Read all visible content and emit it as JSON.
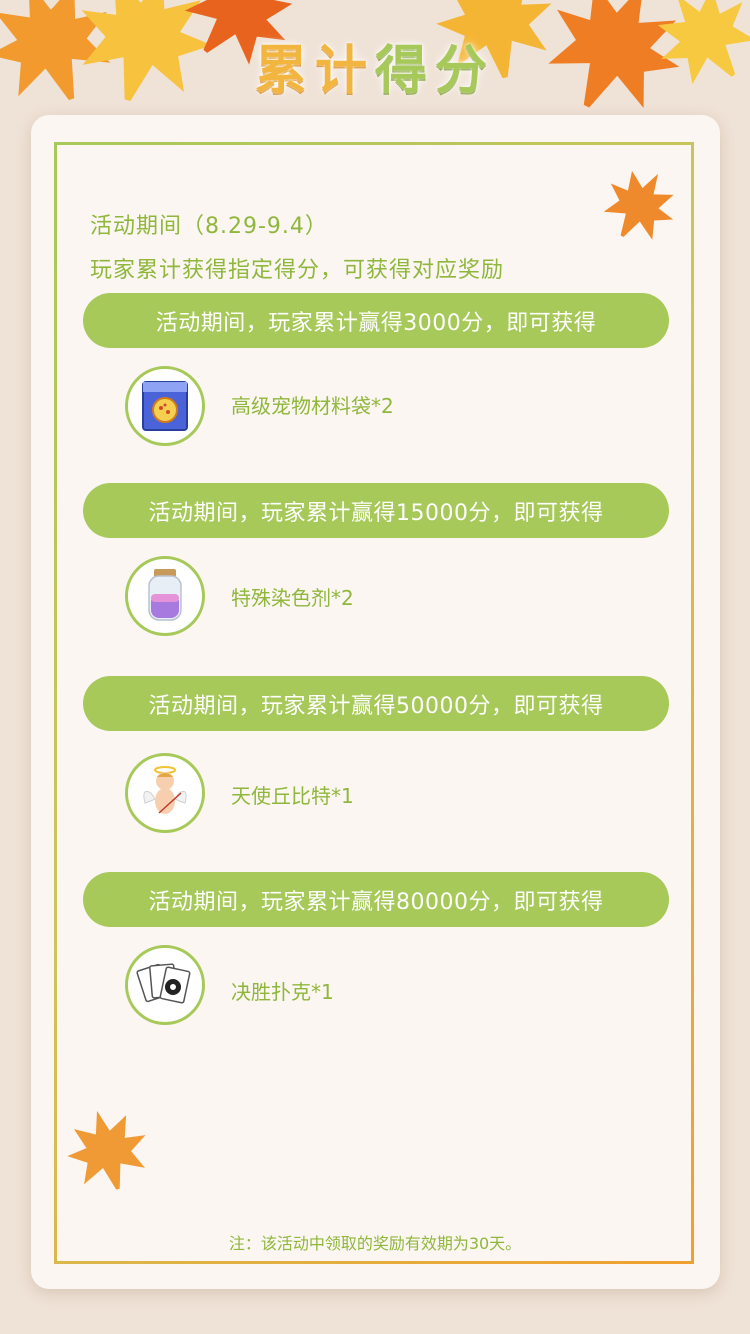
{
  "header": {
    "title_chars": [
      "累",
      "计",
      "得",
      "分"
    ]
  },
  "intro": {
    "period": "活动期间（8.29-9.4）",
    "description": "玩家累计获得指定得分，可获得对应奖励"
  },
  "tiers": [
    {
      "requirement": "活动期间，玩家累计赢得3000分，即可获得",
      "reward": "高级宠物材料袋*2",
      "icon": "material-bag-icon"
    },
    {
      "requirement": "活动期间，玩家累计赢得15000分，即可获得",
      "reward": "特殊染色剂*2",
      "icon": "dye-jar-icon"
    },
    {
      "requirement": "活动期间，玩家累计赢得50000分，即可获得",
      "reward": "天使丘比特*1",
      "icon": "cupid-icon"
    },
    {
      "requirement": "活动期间，玩家累计赢得80000分，即可获得",
      "reward": "决胜扑克*1",
      "icon": "poker-cards-icon"
    }
  ],
  "footer": {
    "note": "注：该活动中领取的奖励有效期为30天。"
  },
  "colors": {
    "accent_green": "#a7c95a",
    "text_green": "#8fb73c",
    "leaf_orange": "#f08a24",
    "leaf_yellow": "#f6c23a",
    "background": "#efe2d6"
  }
}
